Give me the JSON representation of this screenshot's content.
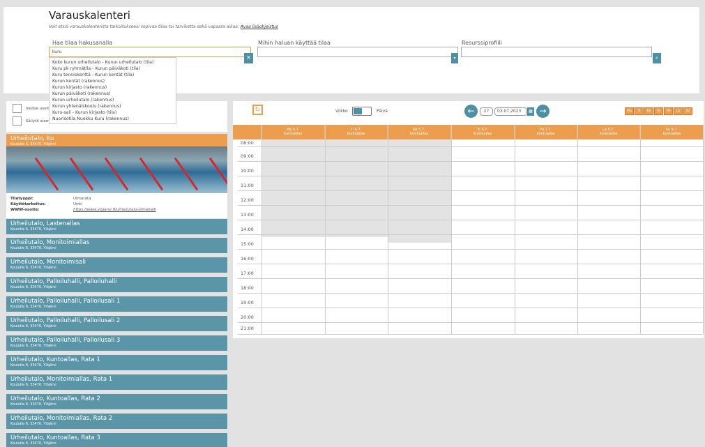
{
  "header": {
    "title": "Varauskalenteri",
    "intro_text": "Voit etsiä varauskalenterista tarkoitukseesi sopivaa tilaa tai tarviketta sekä vapaata aikaa.",
    "intro_link": "Avaa lisäohjeistus"
  },
  "search": {
    "label": "Hae tilaa hakusanalla",
    "value": "kuru",
    "clear_icon": "×"
  },
  "purpose": {
    "label": "Mihin haluan käyttää tilaa",
    "value": ""
  },
  "profile": {
    "label": "Resurssiprofiili",
    "value": ""
  },
  "dropdown_items": [
    "Koko kurun urheilutalo - Kurun urheilutalo (tila)",
    "Kuru pk ryhmätila - Kurun päiväkoti (tila)",
    "Kuru tenniskenttä - Kurun kentät (tila)",
    "Kurun kentät (rakennus)",
    "Kurun kirjasto (rakennus)",
    "Kurun päiväkoti (rakennus)",
    "Kurun urheilutalo (rakennus)",
    "Kurun yhtenäiskoulu (rakennus)",
    "Kuru-sali - Kurun kirjasto (tila)",
    "Nuorisotila Nuokku Kuru (rakennus)"
  ],
  "sidebar": {
    "checkbox1": "Valitse useita",
    "checkbox2": "Säilytä aiemmat",
    "selected": {
      "name": "Urheilutalo, Ku",
      "address": "Koulutie 6, 33470, Ylöjärvi"
    },
    "info": {
      "type_key": "Tilatyyppi:",
      "type_val": "Uimarata",
      "purpose_key": "Käyttötarkoitus:",
      "purpose_val": "Uinti",
      "www_key": "WWW-osoite:",
      "www_val": "https://www.ylojarvi.fi/urheilutalo-uimahalli"
    },
    "places": [
      {
        "name": "Urheilutalo, Lastenallas",
        "address": "Koulutie 6, 33470, Ylöjärvi"
      },
      {
        "name": "Urheilutalo, Monitoimiallas",
        "address": "Koulutie 6, 33470, Ylöjärvi"
      },
      {
        "name": "Urheilutalo, Monitoimisali",
        "address": "Koulutie 6, 33470, Ylöjärvi"
      },
      {
        "name": "Urheilutalo, Palloiluhalli, Palloiluhalli",
        "address": "Koulutie 6, 33470, Ylöjärvi"
      },
      {
        "name": "Urheilutalo, Palloiluhalli, Palloilusali 1",
        "address": "Koulutie 6, 33470, Ylöjärvi"
      },
      {
        "name": "Urheilutalo, Palloiluhalli, Palloilusali 2",
        "address": "Koulutie 6, 33470, Ylöjärvi"
      },
      {
        "name": "Urheilutalo, Palloiluhalli, Palloilusali 3",
        "address": "Koulutie 6, 33470, Ylöjärvi"
      },
      {
        "name": "Urheilutalo, Kuntoallas, Rata 1",
        "address": "Koulutie 6, 33470, Ylöjärvi"
      },
      {
        "name": "Urheilutalo, Monitoimiallas, Rata 1",
        "address": "Koulutie 6, 33470, Ylöjärvi"
      },
      {
        "name": "Urheilutalo, Kuntoallas, Rata 2",
        "address": "Koulutie 6, 33470, Ylöjärvi"
      },
      {
        "name": "Urheilutalo, Monitoimiallas, Rata 2",
        "address": "Koulutie 6, 33470, Ylöjärvi"
      },
      {
        "name": "Urheilutalo, Kuntoallas, Rata 3",
        "address": "Koulutie 6, 33470, Ylöjärvi"
      }
    ]
  },
  "calendar": {
    "refresh_icon": "↻",
    "view_week": "Viikko",
    "view_day": "Päivä",
    "prev_icon": "←",
    "next_icon": "→",
    "week_number": "27",
    "date": "03.07.2023",
    "calendar_icon": "▦",
    "day_buttons": [
      "Ma",
      "Ti",
      "Ke",
      "To",
      "Pe",
      "La",
      "Su"
    ],
    "days": [
      {
        "date": "Ma 3.7.",
        "sub": "Kuntoallas"
      },
      {
        "date": "Ti 4.7.",
        "sub": "Kuntoallas"
      },
      {
        "date": "Ke 5.7.",
        "sub": "Kuntoallas"
      },
      {
        "date": "To 6.7.",
        "sub": "Kuntoallas"
      },
      {
        "date": "Pe 7.7.",
        "sub": "Kuntoallas"
      },
      {
        "date": "La 8.7.",
        "sub": "Kuntoallas"
      },
      {
        "date": "Su 9.7.",
        "sub": "Kuntoallas"
      }
    ],
    "times": [
      "08:00",
      "09:00",
      "10:00",
      "11:00",
      "12:00",
      "13:00",
      "14:00",
      "15:00",
      "16:00",
      "17:00",
      "18:00",
      "19:00",
      "20:00",
      "21:00"
    ]
  },
  "colors": {
    "accent": "#ec9d4d",
    "teal": "#5a96a8",
    "button": "#4d8fa3"
  }
}
